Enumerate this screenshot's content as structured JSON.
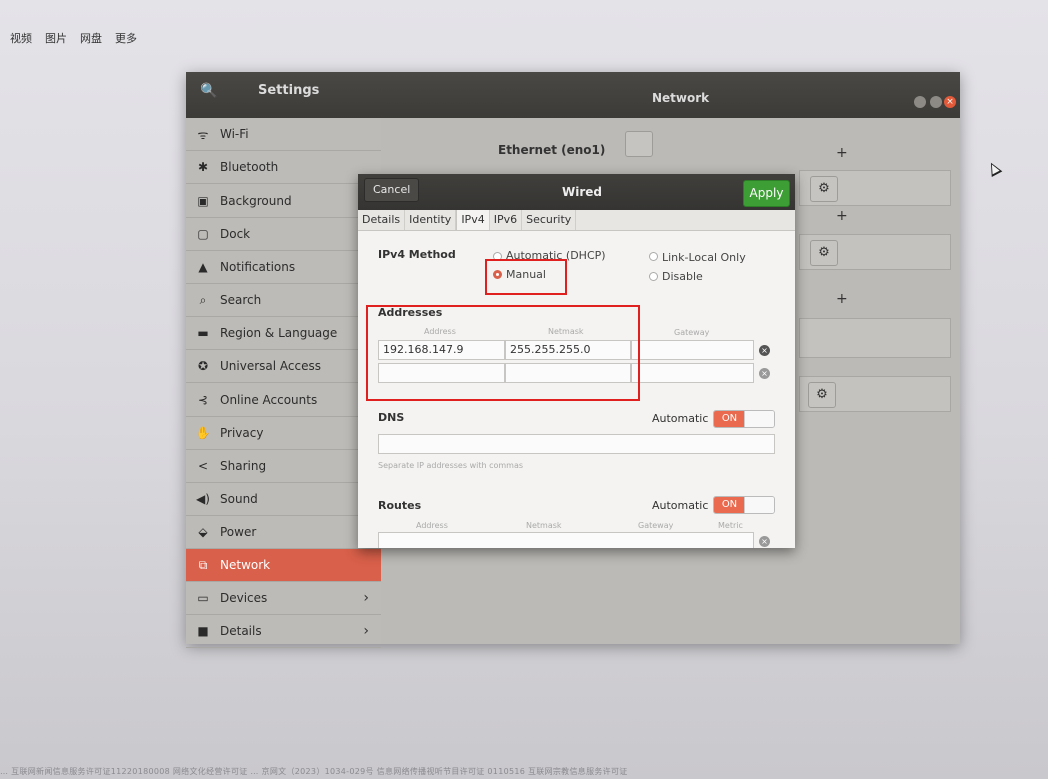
{
  "browser": {
    "nav": [
      "视频",
      "图片",
      "网盘",
      "更多"
    ],
    "footer": "… 互联网新闻信息服务许可证11220180008  网络文化经营许可证 … 京网文（2023）1034-029号  信息网络传播视听节目许可证 0110516  互联网宗教信息服务许可证"
  },
  "window": {
    "search_icon": "🔍",
    "settings_title": "Settings",
    "panel_title": "Network",
    "close_glyph": "×"
  },
  "sidebar": {
    "items": [
      {
        "label": "Wi-Fi",
        "icon": "wifi-icon",
        "glyph": "ᯤ"
      },
      {
        "label": "Bluetooth",
        "icon": "bluetooth-icon",
        "glyph": "✱"
      },
      {
        "label": "Background",
        "icon": "background-icon",
        "glyph": "▣"
      },
      {
        "label": "Dock",
        "icon": "dock-icon",
        "glyph": "▢"
      },
      {
        "label": "Notifications",
        "icon": "bell-icon",
        "glyph": "▲"
      },
      {
        "label": "Search",
        "icon": "search-icon",
        "glyph": "⌕"
      },
      {
        "label": "Region & Language",
        "icon": "region-icon",
        "glyph": "▬"
      },
      {
        "label": "Universal Access",
        "icon": "accessibility-icon",
        "glyph": "✪"
      },
      {
        "label": "Online Accounts",
        "icon": "online-accounts-icon",
        "glyph": "⊰"
      },
      {
        "label": "Privacy",
        "icon": "privacy-icon",
        "glyph": "✋"
      },
      {
        "label": "Sharing",
        "icon": "share-icon",
        "glyph": "<"
      },
      {
        "label": "Sound",
        "icon": "sound-icon",
        "glyph": "◀)"
      },
      {
        "label": "Power",
        "icon": "power-icon",
        "glyph": "⬙"
      },
      {
        "label": "Network",
        "icon": "network-icon",
        "glyph": "⧉"
      },
      {
        "label": "Devices",
        "icon": "devices-icon",
        "glyph": "▭"
      },
      {
        "label": "Details",
        "icon": "details-icon",
        "glyph": "■"
      }
    ],
    "chevron": "›"
  },
  "network": {
    "ethernet_title": "Ethernet (eno1)",
    "plus": "+",
    "gear": "⚙"
  },
  "dialog": {
    "cancel": "Cancel",
    "title": "Wired",
    "apply": "Apply",
    "tabs": [
      "Details",
      "Identity",
      "IPv4",
      "IPv6",
      "Security"
    ],
    "ipv4_method_label": "IPv4 Method",
    "methods": {
      "automatic": "Automatic (DHCP)",
      "link_local": "Link-Local Only",
      "manual": "Manual",
      "disable": "Disable"
    },
    "addresses_label": "Addresses",
    "col_address": "Address",
    "col_netmask": "Netmask",
    "col_gateway": "Gateway",
    "row1": {
      "address": "192.168.147.9",
      "netmask": "255.255.255.0",
      "gateway": ""
    },
    "dns_label": "DNS",
    "automatic_label": "Automatic",
    "on_label": "ON",
    "dns_hint": "Separate IP addresses with commas",
    "routes_label": "Routes",
    "col_metric": "Metric",
    "x": "×"
  },
  "colors": {
    "accent": "#d9604a",
    "apply": "#3c9e35",
    "highlight": "#e01f1f"
  }
}
